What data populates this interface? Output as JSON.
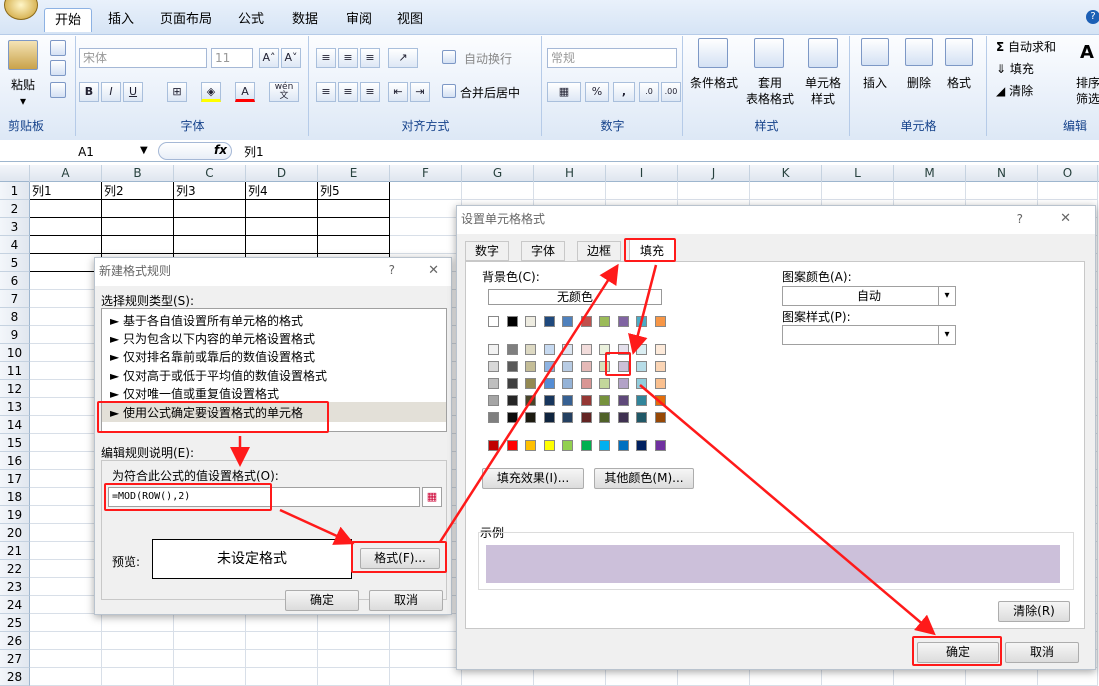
{
  "ribbon": {
    "tabs": [
      "开始",
      "插入",
      "页面布局",
      "公式",
      "数据",
      "审阅",
      "视图"
    ],
    "groups": {
      "clipboard": "剪贴板",
      "font": "字体",
      "align": "对齐方式",
      "number": "数字",
      "style": "样式",
      "cells": "单元格",
      "edit": "编辑"
    },
    "paste": "粘贴",
    "font_name": "宋体",
    "font_size": "11",
    "wrap": "自动换行",
    "merge": "合并后居中",
    "number_format": "常规",
    "percent": "%",
    "comma": ",",
    "cond_format": "条件格式",
    "table_format_1": "套用",
    "table_format_2": "表格格式",
    "cell_style_1": "单元格",
    "cell_style_2": "样式",
    "insert": "插入",
    "delete": "删除",
    "format": "格式",
    "autosum": "自动求和",
    "fill": "填充",
    "clear": "清除",
    "sort_1": "排序",
    "sort_2": "筛选",
    "bold": "B",
    "italic": "I",
    "underline": "U",
    "font_color": "A",
    "wen": "wén",
    "wen_char": "文"
  },
  "formula_bar": {
    "name_box": "A1",
    "fx": "fx",
    "content": "列1"
  },
  "sheet": {
    "columns": [
      "A",
      "B",
      "C",
      "D",
      "E",
      "F",
      "G",
      "H",
      "I",
      "J",
      "K",
      "L",
      "M",
      "N",
      "O"
    ],
    "rows": [
      "1",
      "2",
      "3",
      "4",
      "5",
      "6",
      "7",
      "8",
      "9",
      "10",
      "11",
      "12",
      "13",
      "14",
      "15",
      "16",
      "17",
      "18",
      "19",
      "20",
      "21",
      "22",
      "23",
      "24",
      "25",
      "26",
      "27",
      "28"
    ],
    "row1": [
      "列1",
      "列2",
      "列3",
      "列4",
      "列5"
    ]
  },
  "rule_dialog": {
    "title": "新建格式规则",
    "help": "?",
    "close": "✕",
    "select_label": "选择规则类型(S):",
    "rules": [
      "► 基于各自值设置所有单元格的格式",
      "► 只为包含以下内容的单元格设置格式",
      "► 仅对排名靠前或靠后的数值设置格式",
      "► 仅对高于或低于平均值的数值设置格式",
      "► 仅对唯一值或重复值设置格式",
      "► 使用公式确定要设置格式的单元格"
    ],
    "edit_label": "编辑规则说明(E):",
    "formula_label": "为符合此公式的值设置格式(O):",
    "formula": "=MOD(ROW(),2)",
    "preview_label": "预览:",
    "preview_text": "未设定格式",
    "format_btn": "格式(F)...",
    "ok": "确定",
    "cancel": "取消"
  },
  "cell_dialog": {
    "title": "设置单元格格式",
    "help": "?",
    "close": "✕",
    "tabs": [
      "数字",
      "字体",
      "边框",
      "填充"
    ],
    "bg_label": "背景色(C):",
    "no_color": "无颜色",
    "pattern_color_label": "图案颜色(A):",
    "pattern_color": "自动",
    "pattern_style_label": "图案样式(P):",
    "fill_effects": "填充效果(I)...",
    "more_colors": "其他颜色(M)...",
    "sample_label": "示例",
    "sample_color": "#ccc0da",
    "clear": "清除(R)",
    "ok": "确定",
    "cancel": "取消"
  },
  "palette": {
    "theme_top": [
      "#ffffff",
      "#000000",
      "#eeece1",
      "#1f497d",
      "#4f81bd",
      "#c0504d",
      "#9bbb59",
      "#8064a2",
      "#4bacc6",
      "#f79646"
    ],
    "theme_rows": [
      [
        "#f2f2f2",
        "#7f7f7f",
        "#ddd9c3",
        "#c6d9f0",
        "#dbe5f1",
        "#f2dcdb",
        "#ebf1dd",
        "#e5e0ec",
        "#dbeef3",
        "#fdeada"
      ],
      [
        "#d8d8d8",
        "#595959",
        "#c4bd97",
        "#8db3e2",
        "#b8cce4",
        "#e5b9b7",
        "#d7e3bc",
        "#ccc1d9",
        "#b7dde8",
        "#fbd5b5"
      ],
      [
        "#bfbfbf",
        "#3f3f3f",
        "#938953",
        "#548dd4",
        "#95b3d7",
        "#d99694",
        "#c3d69b",
        "#b2a2c7",
        "#92cddc",
        "#fac08f"
      ],
      [
        "#a5a5a5",
        "#262626",
        "#494429",
        "#17365d",
        "#366092",
        "#953734",
        "#76923c",
        "#5f497a",
        "#31859b",
        "#e36c09"
      ],
      [
        "#7f7f7f",
        "#0c0c0c",
        "#1d1b10",
        "#0f243e",
        "#244061",
        "#632423",
        "#4f6128",
        "#3f3151",
        "#205867",
        "#974806"
      ]
    ],
    "standard": [
      "#c00000",
      "#ff0000",
      "#ffc000",
      "#ffff00",
      "#92d050",
      "#00b050",
      "#00b0f0",
      "#0070c0",
      "#002060",
      "#7030a0"
    ]
  },
  "accent": "#ff1a1a"
}
